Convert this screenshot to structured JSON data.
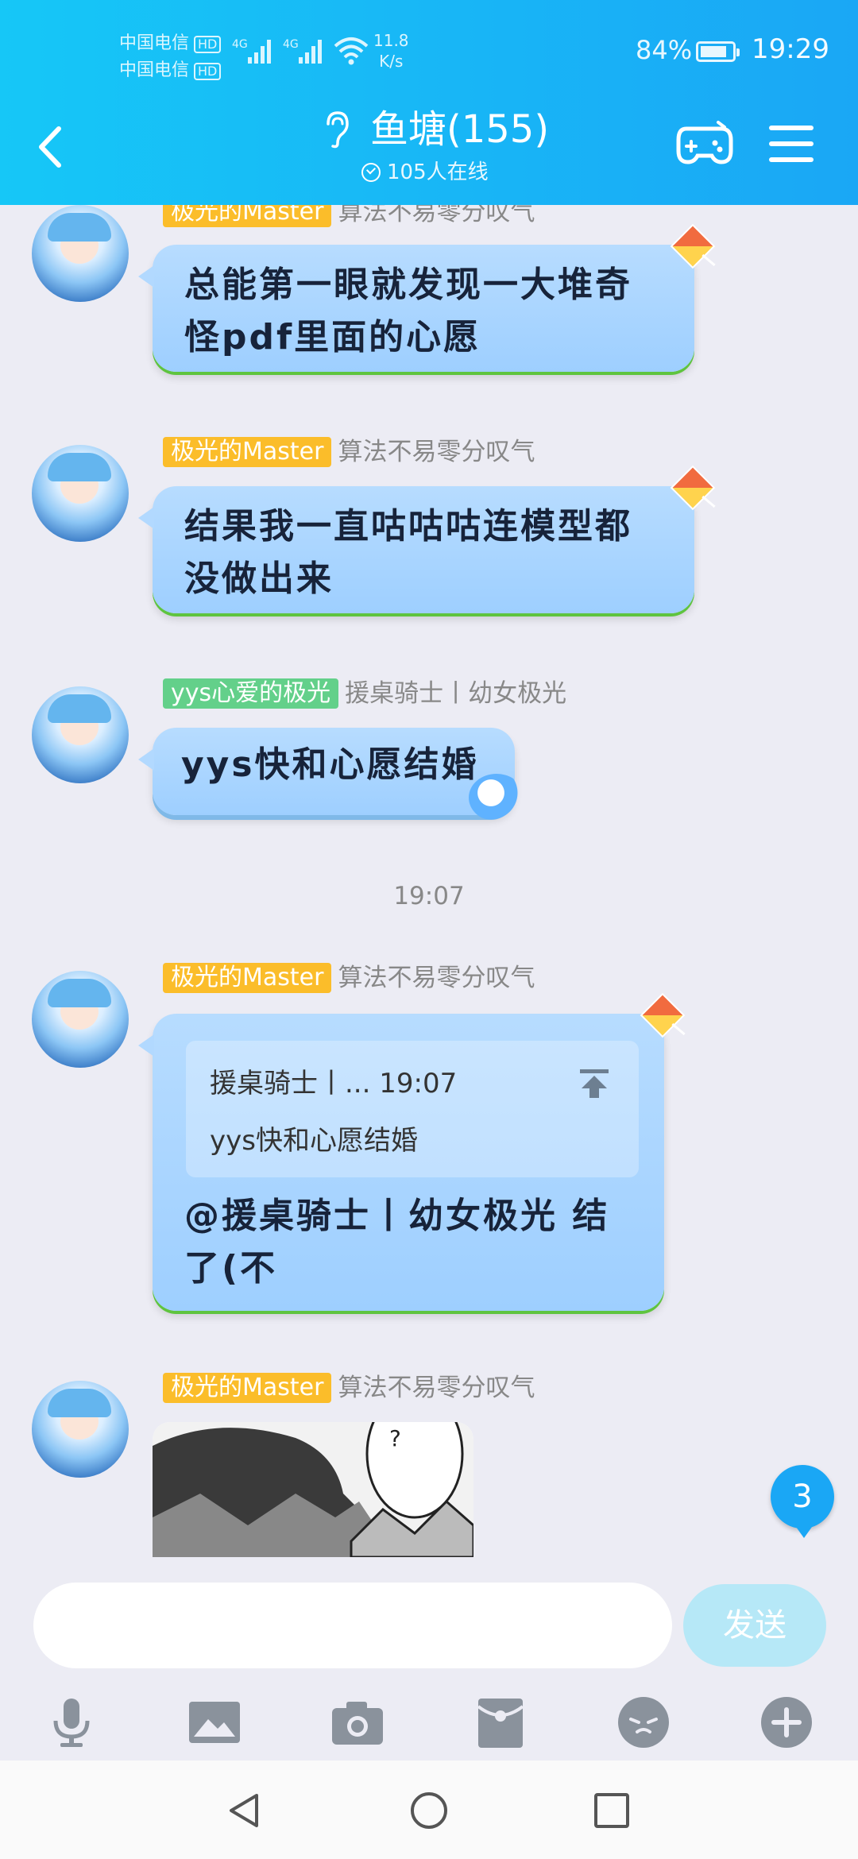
{
  "status_bar": {
    "carrier1": "中国电信",
    "carrier2": "中国电信",
    "hd_badge": "HD",
    "network": "4G",
    "net_speed_value": "11.8",
    "net_speed_unit": "K/s",
    "battery_percent": "84%",
    "battery_level": 0.84,
    "time": "19:29"
  },
  "header": {
    "title": "鱼塘(155)",
    "online": "105人在线",
    "icons": [
      "back-icon",
      "ear-icon",
      "gamepad-icon",
      "menu-icon"
    ]
  },
  "messages": [
    {
      "tag": "极光的Master",
      "tag_color": "#fbbd2a",
      "nickname": "算法不易零分叹气",
      "line1": "总能第一眼就发现一大堆奇",
      "line2": "怪pdf里面的心愿"
    },
    {
      "tag": "极光的Master",
      "tag_color": "#fbbd2a",
      "nickname": "算法不易零分叹气",
      "line1": "结果我一直咕咕咕连模型都",
      "line2": "没做出来"
    },
    {
      "tag": "yys心爱的极光",
      "tag_color": "#63d08a",
      "nickname": "援桌骑士丨幼女极光",
      "line1": "yys快和心愿结婚"
    },
    {
      "tag": "极光的Master",
      "tag_color": "#fbbd2a",
      "nickname": "算法不易零分叹气",
      "quote_header": "援桌骑士丨... 19:07",
      "quote_body": "yys快和心愿结婚",
      "line1": "@援桌骑士丨幼女极光 结",
      "line2": "了(不"
    },
    {
      "tag": "极光的Master",
      "tag_color": "#fbbd2a",
      "nickname": "算法不易零分叹气",
      "image_text": "?"
    }
  ],
  "timestamp": "19:07",
  "unread_count": "3",
  "input": {
    "placeholder": "",
    "value": "",
    "send_label": "发送"
  },
  "toolbar_icons": [
    "microphone-icon",
    "image-icon",
    "camera-icon",
    "red-packet-icon",
    "emoji-icon",
    "plus-icon"
  ],
  "nav_icons": [
    "back-triangle-icon",
    "home-circle-icon",
    "recents-square-icon"
  ],
  "colors": {
    "header_start": "#16c7f7",
    "header_end": "#1aa7f5",
    "bubble": "#a8d4ff",
    "send_button": "#b6e8f7",
    "chat_background": "#ececf4"
  }
}
